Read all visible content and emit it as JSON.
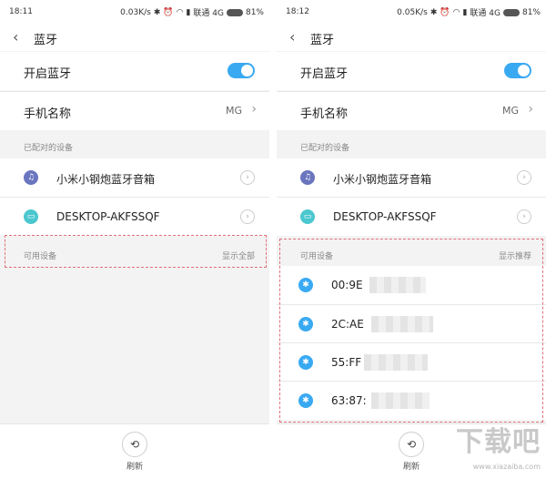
{
  "status_left": {
    "time": "18:11",
    "speed": "0.03K/s",
    "carrier": "联通 4G",
    "battery": "81%"
  },
  "status_right": {
    "time": "18:12",
    "speed": "0.05K/s",
    "carrier": "联通 4G",
    "battery": "81%"
  },
  "page_title": "蓝牙",
  "toggle_label": "开启蓝牙",
  "toggle_on": true,
  "device_name_label": "手机名称",
  "device_name_value": "MG",
  "paired_header": "已配对的设备",
  "paired_devices": [
    {
      "name": "小米小钢炮蓝牙音箱",
      "icon": "headphone-icon"
    },
    {
      "name": "DESKTOP-AKFSSQF",
      "icon": "monitor-icon"
    }
  ],
  "available_header": "可用设备",
  "left_available_action": "显示全部",
  "right_available_action": "显示推荐",
  "available_devices": [
    {
      "name": "00:9E"
    },
    {
      "name": "2C:AE"
    },
    {
      "name": "55:FF"
    },
    {
      "name": "63:87:"
    }
  ],
  "scan_label": "刷新",
  "watermark": "下载吧",
  "watermark_url": "www.xiazaiba.com",
  "colors": {
    "accent": "#39a9f2",
    "dashed": "#e0707a"
  }
}
